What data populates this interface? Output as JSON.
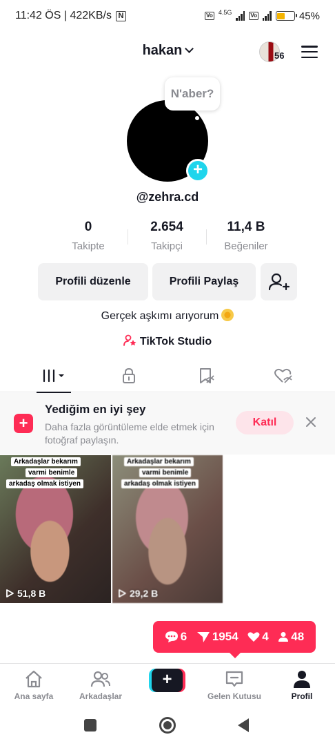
{
  "status_bar": {
    "time_info": "11:42 ÖS | 422KB/s",
    "network": "4.5G",
    "volte": "Vo LTE",
    "battery": "45%",
    "battery_level": 0.45
  },
  "header": {
    "username": "hakan",
    "story_count": "56"
  },
  "profile": {
    "bubble_text": "N'aber?",
    "handle": "@zehra.cd",
    "stats": [
      {
        "value": "0",
        "label": "Takipte"
      },
      {
        "value": "2.654",
        "label": "Takipçi"
      },
      {
        "value": "11,4 B",
        "label": "Beğeniler"
      }
    ],
    "edit_button": "Profili düzenle",
    "share_button": "Profili Paylaş",
    "bio": "Gerçek aşkımı arıyorum",
    "studio_link": "TikTok Studio"
  },
  "promo": {
    "title": "Yediğim en iyi şey",
    "subtitle": "Daha fazla görüntüleme elde etmek için fotoğraf paylaşın.",
    "join_label": "Katıl"
  },
  "videos": [
    {
      "caption_lines": [
        "Arkadaşlar bekarım",
        "varmi benimle",
        "arkadaş olmak istiyen"
      ],
      "views": "51,8 B"
    },
    {
      "caption_lines": [
        "Arkadaşlar bekarım",
        "varmi benimle",
        "arkadaş olmak istiyen"
      ],
      "views": "29,2 B"
    }
  ],
  "notifications": {
    "comments": "6",
    "shares": "1954",
    "likes": "4",
    "followers": "48"
  },
  "bottom_nav": {
    "home": "Ana sayfa",
    "friends": "Arkadaşlar",
    "inbox": "Gelen Kutusu",
    "profile": "Profil"
  },
  "colors": {
    "accent": "#fe2c55",
    "cyan": "#20d5ec",
    "text": "#161823",
    "muted": "#8a8b91"
  }
}
